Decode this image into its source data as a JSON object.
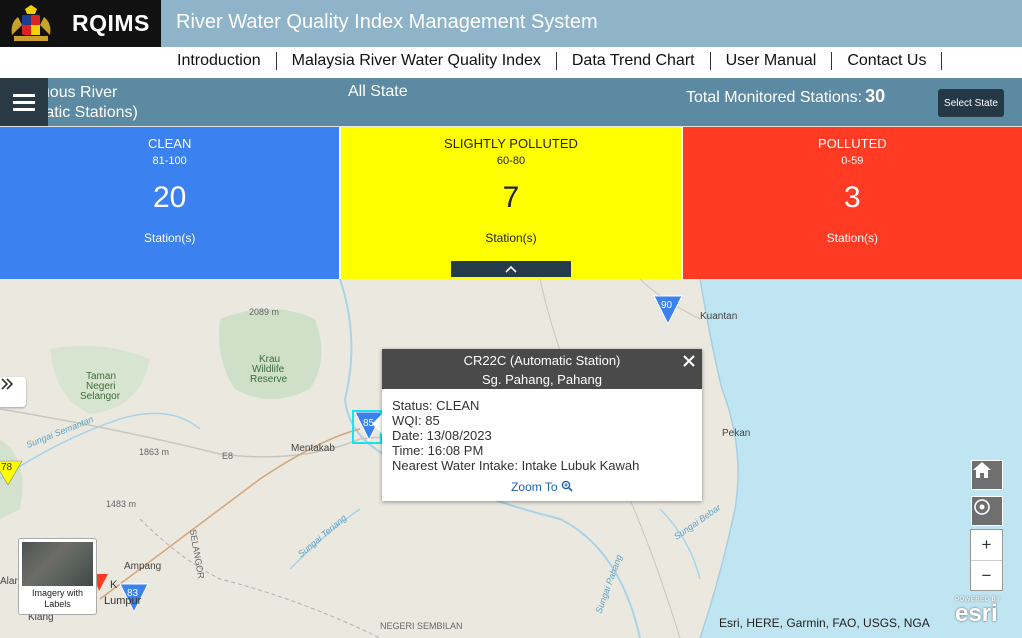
{
  "header": {
    "brand": "RQIMS",
    "system_title": "River Water Quality Index Management System"
  },
  "nav": {
    "items": [
      {
        "label": "Introduction"
      },
      {
        "label": "Malaysia River Water Quality Index"
      },
      {
        "label": "Data Trend Chart"
      },
      {
        "label": "User Manual"
      },
      {
        "label": "Contact Us"
      }
    ]
  },
  "statusbar": {
    "title_line1": "nuous River",
    "title_line2": "matic Stations)",
    "state": "All State",
    "total_label": "Total Monitored Stations:",
    "total_value": "30",
    "select_state_label": "Select State"
  },
  "cards": [
    {
      "title": "CLEAN",
      "range": "81-100",
      "count": "20",
      "unit": "Station(s)",
      "color": "#3b82f0"
    },
    {
      "title": "SLIGHTLY POLLUTED",
      "range": "60-80",
      "count": "7",
      "unit": "Station(s)",
      "color": "#ffff00"
    },
    {
      "title": "POLLUTED",
      "range": "0-59",
      "count": "3",
      "unit": "Station(s)",
      "color": "#ff3b24"
    }
  ],
  "map": {
    "labels": {
      "kuantan": "Kuantan",
      "pekan": "Pekan",
      "mentakab": "Mentakab",
      "ampang": "Ampang",
      "kl1": "K",
      "kl2": "Lumpur",
      "alam": "Alan",
      "klang": "Klang",
      "taman1": "Taman",
      "taman2": "Negeri",
      "taman3": "Selangor",
      "krau1": "Krau",
      "krau2": "Wildlife",
      "krau3": "Reserve",
      "elev1": "2089 m",
      "elev2": "1863 m",
      "elev3": "1483 m",
      "road1": "E8",
      "selangor": "SELANGOR",
      "negeri": "NEGERI SEMBILAN",
      "river1": "Sungai Semantan",
      "river2": "Sungai Teriang",
      "river3": "Sungai Bebar",
      "river4": "Sungai Pahang"
    },
    "markers": [
      {
        "value": "90",
        "status": "clean"
      },
      {
        "value": "85",
        "status": "clean"
      },
      {
        "value": "78",
        "status": "slightly-polluted"
      },
      {
        "value": "83",
        "status": "clean"
      }
    ],
    "basemap_label": "Imagery with Labels",
    "attribution": "Esri, HERE, Garmin, FAO, USGS, NGA",
    "esri_powered": "POWERED BY",
    "esri_name": "esri"
  },
  "popup": {
    "station": "CR22C (Automatic Station)",
    "river": "Sg. Pahang, Pahang",
    "status": "Status: CLEAN",
    "wqi": "WQI: 85",
    "date": "Date: 13/08/2023",
    "time": "Time: 16:08 PM",
    "intake": "Nearest Water Intake: Intake Lubuk Kawah",
    "zoom_label": "Zoom To"
  }
}
